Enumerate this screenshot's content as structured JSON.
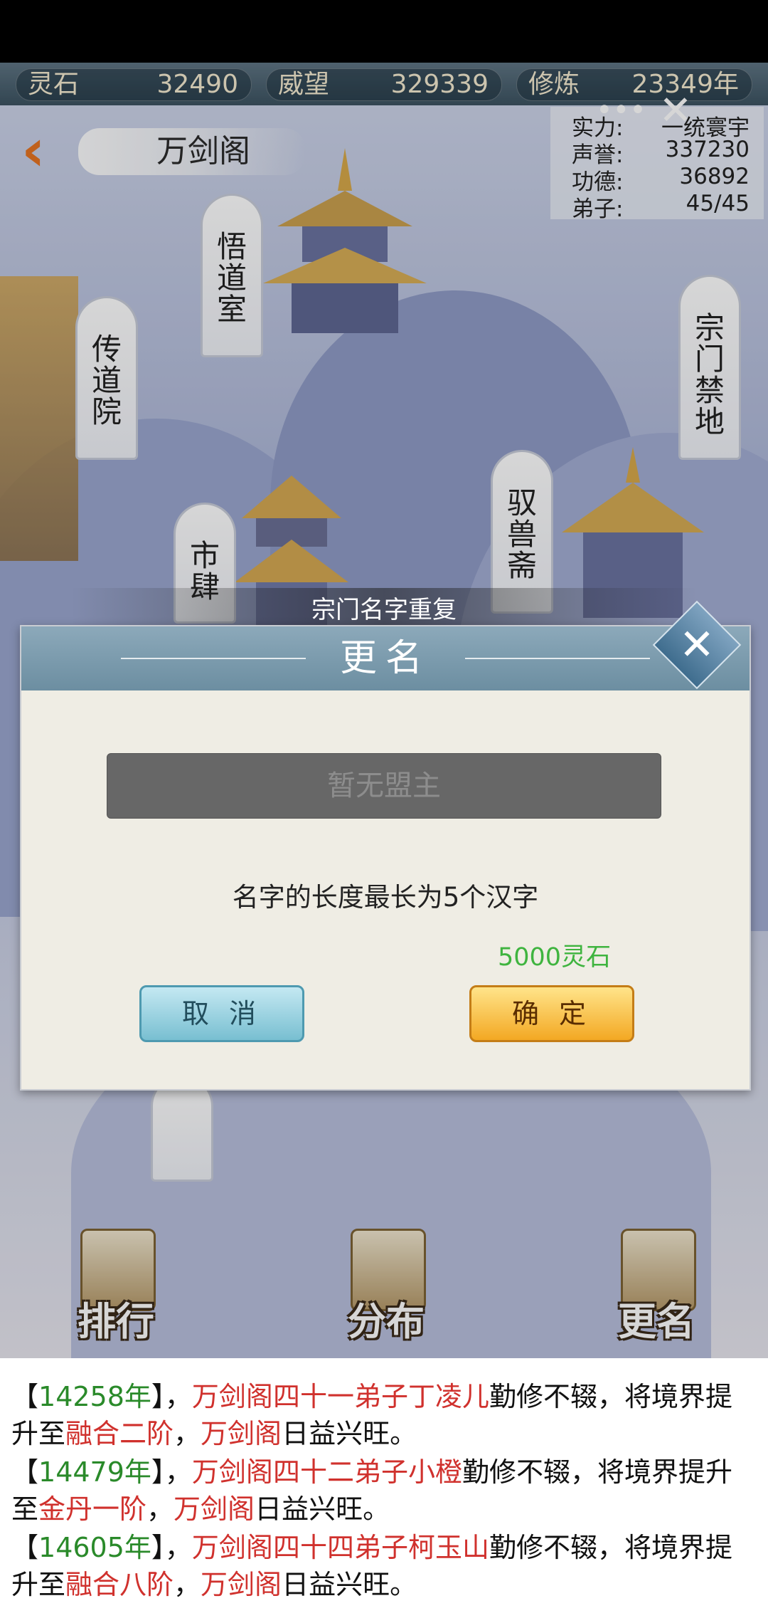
{
  "resources": [
    {
      "label": "灵石",
      "value": "32490"
    },
    {
      "label": "威望",
      "value": "329339"
    },
    {
      "label": "修炼",
      "value": "23349年"
    }
  ],
  "sect_info": [
    {
      "label": "实力:",
      "value": "一统寰宇"
    },
    {
      "label": "声誉:",
      "value": "337230"
    },
    {
      "label": "功德:",
      "value": "36892"
    },
    {
      "label": "弟子:",
      "value": "45/45"
    }
  ],
  "header": {
    "title": "万剑阁",
    "back_icon": "chevron-left-icon",
    "close_icon": "close-icon"
  },
  "buildings": [
    {
      "id": "wudao",
      "chars": [
        "悟",
        "道",
        "室"
      ]
    },
    {
      "id": "chuandao",
      "chars": [
        "传",
        "道",
        "院"
      ]
    },
    {
      "id": "zongmen",
      "chars": [
        "宗",
        "门",
        "禁",
        "地"
      ]
    },
    {
      "id": "yushou",
      "chars": [
        "驭",
        "兽",
        "斋"
      ]
    },
    {
      "id": "shisi",
      "chars": [
        "市",
        "肆"
      ]
    }
  ],
  "toast": "宗门名字重复",
  "dialog": {
    "title": "更名",
    "input_placeholder": "暂无盟主",
    "hint": "名字的长度最长为5个汉字",
    "cost": "5000灵石",
    "cancel": "取 消",
    "confirm": "确 定"
  },
  "bottom_nav": [
    {
      "label": "排行",
      "icon": "ranking-icon"
    },
    {
      "label": "分布",
      "icon": "distribution-icon"
    },
    {
      "label": "更名",
      "icon": "rename-icon"
    }
  ],
  "news": [
    {
      "open": "【",
      "year": "14258年",
      "close": "】，",
      "sect": "万剑阁",
      "disciple": "四十一弟子丁凌儿",
      "mid": "勤修不辍，将境界提升至",
      "realm": "融合二阶",
      "comma": "，",
      "sect2": "万剑阁",
      "end": "日益兴旺。"
    },
    {
      "open": "【",
      "year": "14479年",
      "close": "】，",
      "sect": "万剑阁",
      "disciple": "四十二弟子小橙",
      "mid": "勤修不辍，将境界提升至",
      "realm": "金丹一阶",
      "comma": "，",
      "sect2": "万剑阁",
      "end": "日益兴旺。"
    },
    {
      "open": "【",
      "year": "14605年",
      "close": "】，",
      "sect": "万剑阁",
      "disciple": "四十四弟子柯玉山",
      "mid": "勤修不辍，将境界提升至",
      "realm": "融合八阶",
      "comma": "，",
      "sect2": "万剑阁",
      "end": "日益兴旺。"
    }
  ],
  "colors": {
    "green": "#2a8a2a",
    "red": "#d0312d",
    "cost_green": "#3fb43f"
  }
}
